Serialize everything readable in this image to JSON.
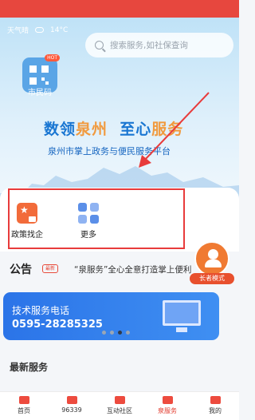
{
  "header": {
    "weather_left": "天气晴",
    "weather_temp": "14°C",
    "search_placeholder": "搜索服务,如社保查询",
    "mini_program": {
      "hot_badge": "HOT",
      "label": "市民码"
    }
  },
  "hero": {
    "slogan_part1": "数领",
    "slogan_accent1": "泉州",
    "slogan_part2": "至心",
    "slogan_accent2": "服务",
    "subtitle": "泉州市掌上政务与便民服务平台"
  },
  "services": [
    {
      "label": "政策找企",
      "icon": "policy-icon"
    },
    {
      "label": "更多",
      "icon": "more-grid-icon"
    }
  ],
  "elder_mode": {
    "label": "长者模式"
  },
  "notice": {
    "title": "公告",
    "tag": "最新",
    "text": "“泉服务”全心全意打造掌上便利"
  },
  "banner": {
    "line1": "技术服务电话",
    "line2": "0595-28285325",
    "active_dot": 2,
    "dot_count": 4
  },
  "section": {
    "latest_services_title": "最新服务"
  },
  "tabbar": [
    {
      "label": "首页",
      "active": false
    },
    {
      "label": "96339",
      "active": false
    },
    {
      "label": "互动社区",
      "active": false
    },
    {
      "label": "泉服务",
      "active": true
    },
    {
      "label": "我的",
      "active": false
    }
  ],
  "colors": {
    "brand_red": "#e7473e",
    "accent_blue": "#1976d2",
    "highlight_box": "#e83b3b"
  }
}
